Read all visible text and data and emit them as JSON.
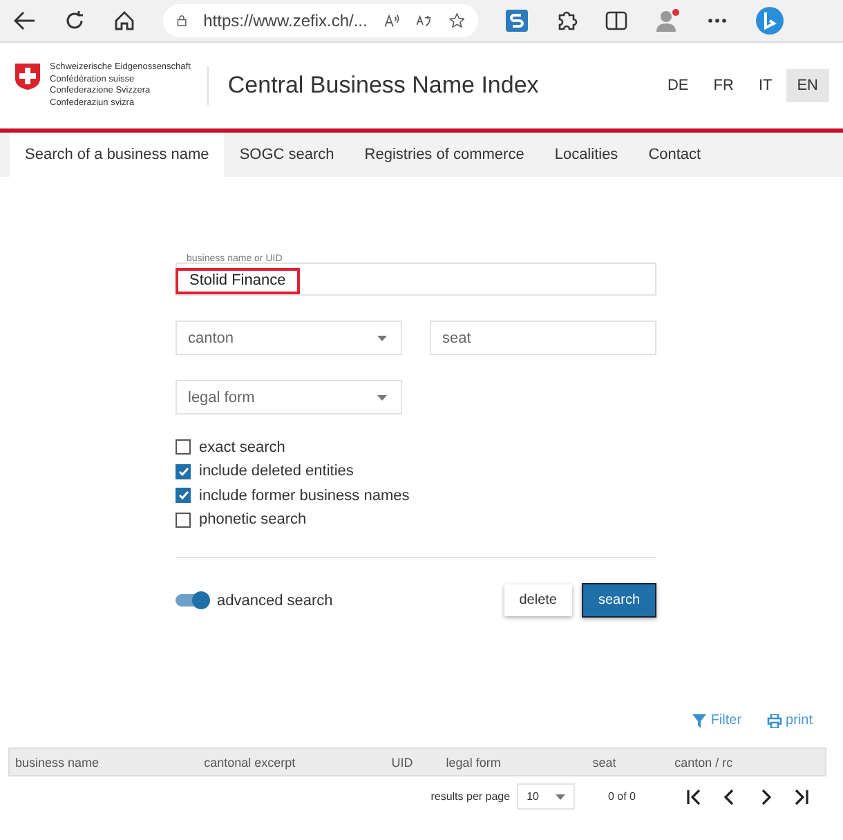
{
  "browser": {
    "url": "https://www.zefix.ch/..."
  },
  "header": {
    "authority_lines": [
      "Schweizerische Eidgenossenschaft",
      "Confédération suisse",
      "Confederazione Svizzera",
      "Confederaziun svizra"
    ],
    "title": "Central Business Name Index",
    "languages": [
      {
        "label": "DE",
        "selected": false
      },
      {
        "label": "FR",
        "selected": false
      },
      {
        "label": "IT",
        "selected": false
      },
      {
        "label": "EN",
        "selected": true
      }
    ]
  },
  "tabs": [
    {
      "label": "Search of a business name",
      "selected": true
    },
    {
      "label": "SOGC search",
      "selected": false
    },
    {
      "label": "Registries of commerce",
      "selected": false
    },
    {
      "label": "Localities",
      "selected": false
    },
    {
      "label": "Contact",
      "selected": false
    }
  ],
  "form": {
    "name_field": {
      "label": "business name or UID",
      "value": "Stolid Finance"
    },
    "canton": {
      "placeholder": "canton"
    },
    "seat": {
      "placeholder": "seat"
    },
    "legal_form": {
      "placeholder": "legal form"
    },
    "options": [
      {
        "label": "exact search",
        "checked": false
      },
      {
        "label": "include deleted entities",
        "checked": true
      },
      {
        "label": "include former business names",
        "checked": true
      },
      {
        "label": "phonetic search",
        "checked": false
      }
    ],
    "advanced_search": {
      "label": "advanced search",
      "on": true
    },
    "buttons": [
      "delete",
      "search"
    ]
  },
  "results": {
    "filter": "Filter",
    "print": "print",
    "columns": [
      "business name",
      "cantonal excerpt",
      "UID",
      "legal form",
      "seat",
      "canton / rc"
    ],
    "per_page_label": "results per page",
    "per_page": "10",
    "count": "0 of 0"
  }
}
